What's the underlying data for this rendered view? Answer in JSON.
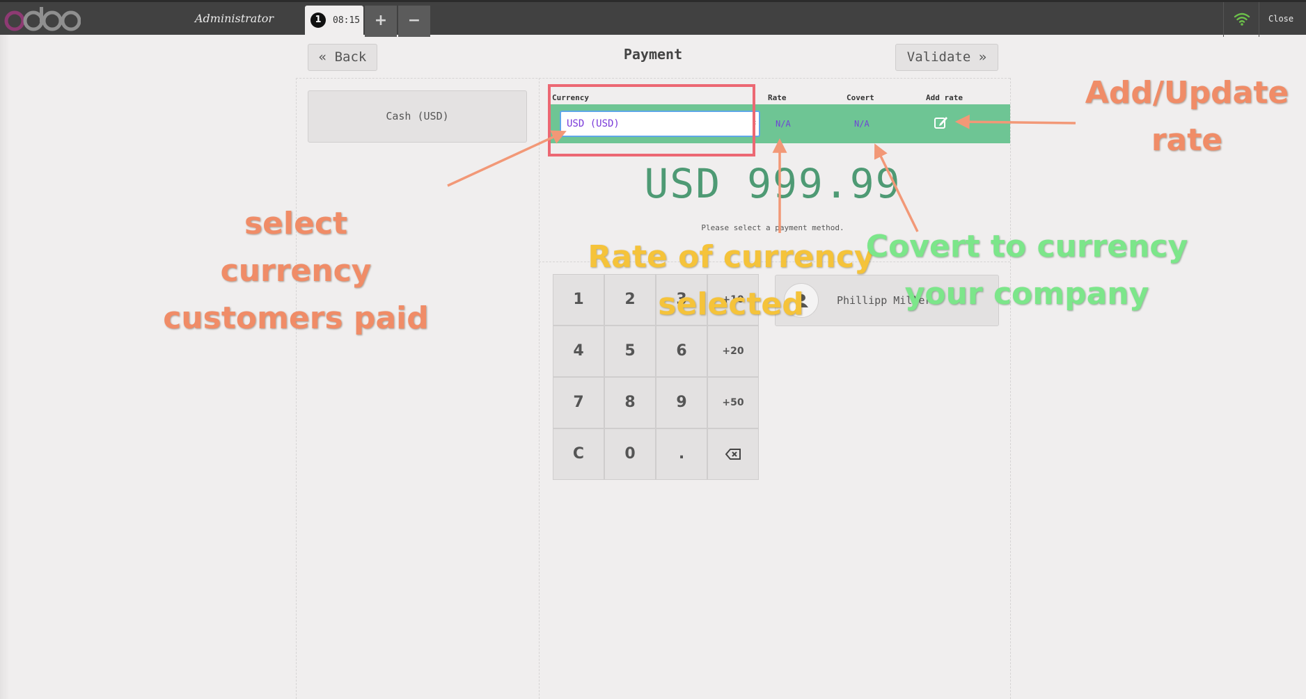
{
  "topbar": {
    "user": "Administrator",
    "order_number": "1",
    "order_time": "08:15",
    "add_order_icon": "plus-icon",
    "remove_order_icon": "minus-icon",
    "connection_icon": "wifi-icon",
    "close_label": "Close"
  },
  "header": {
    "back_label": "Back",
    "title": "Payment",
    "validate_label": "Validate"
  },
  "payment_methods": [
    {
      "label": "Cash (USD)"
    }
  ],
  "currency_table": {
    "headers": {
      "currency": "Currency",
      "rate": "Rate",
      "covert": "Covert",
      "add_rate": "Add rate"
    },
    "selected_currency": "USD (USD)",
    "rate_value": "N/A",
    "covert_value": "N/A",
    "add_rate_icon": "edit-icon"
  },
  "amount_due": "USD 999.99",
  "hint": "Please select a payment method.",
  "numpad": {
    "keys": [
      "1",
      "2",
      "3",
      "+10",
      "4",
      "5",
      "6",
      "+20",
      "7",
      "8",
      "9",
      "+50",
      "C",
      "0",
      ".",
      "backspace"
    ]
  },
  "customer": {
    "name": "Phillipp Miller",
    "icon": "user-icon"
  },
  "annotations": {
    "select_currency": [
      "select",
      "currency",
      "customers paid"
    ],
    "rate_of_currency": [
      "Rate of currency",
      "selected"
    ],
    "covert": [
      "Covert to currency",
      "your company"
    ],
    "add_update_rate": [
      "Add/Update",
      "rate"
    ]
  },
  "colors": {
    "topbar": "#414141",
    "row_highlight": "#6ec594",
    "amount": "#4e9a74",
    "annotation_orange": "#f08c67",
    "annotation_yellow": "#f5c33a",
    "annotation_green": "#7ce68a",
    "highlight_box": "#ec6873"
  }
}
